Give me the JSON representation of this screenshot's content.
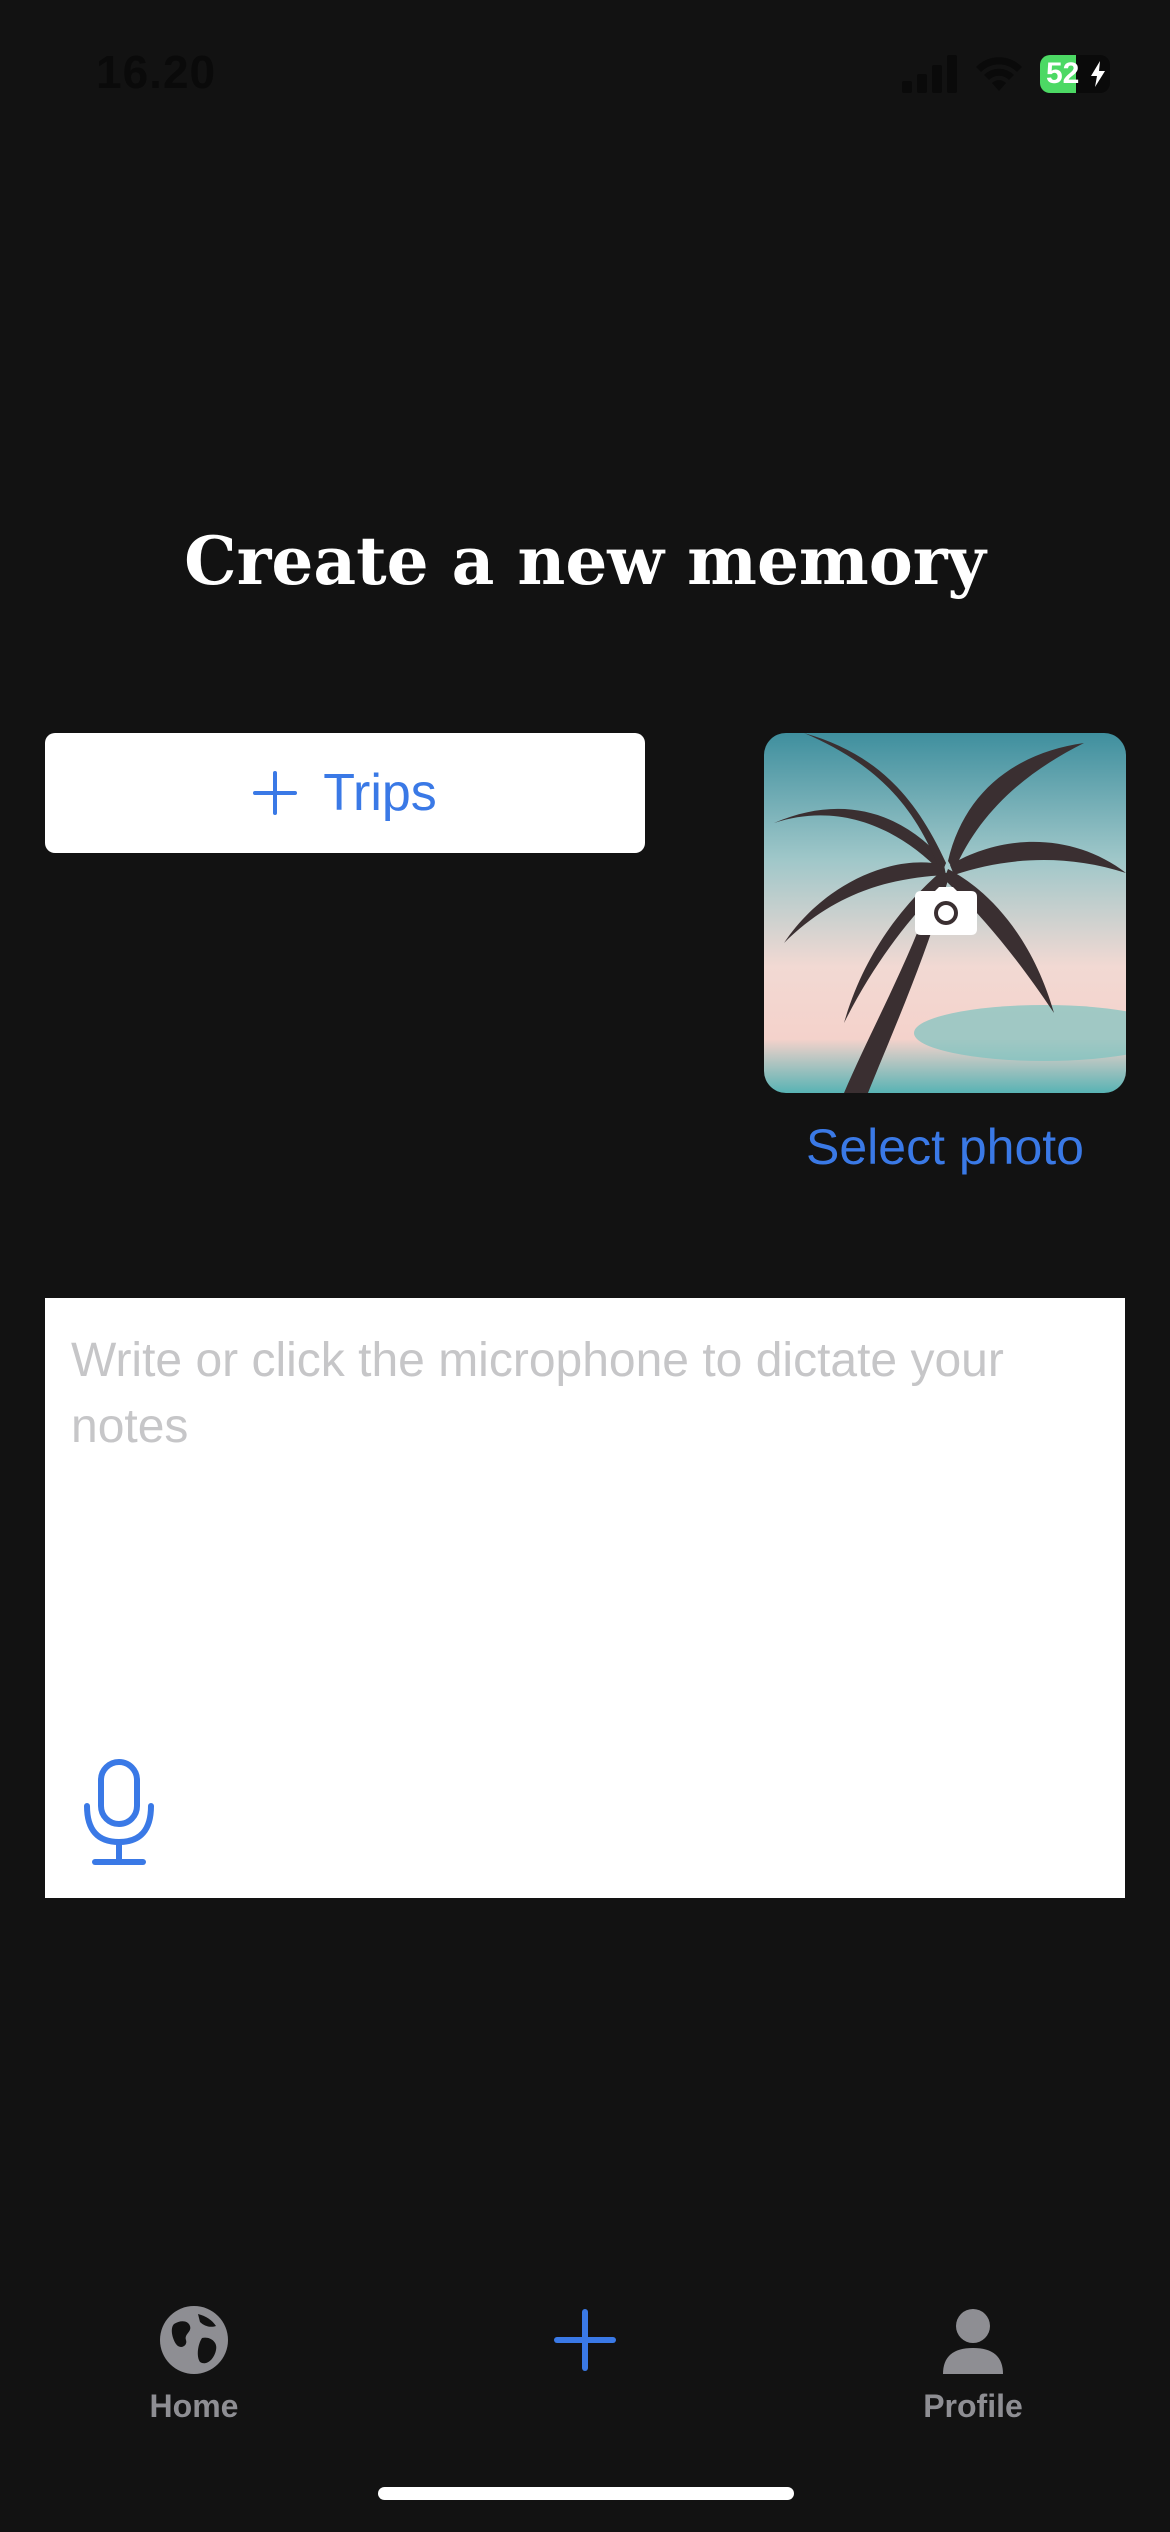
{
  "status_bar": {
    "time": "16.20",
    "battery_percent": "52",
    "battery_level": 0.52,
    "icons": [
      "signal-icon",
      "wifi-icon",
      "battery-icon",
      "charging-bolt-icon"
    ]
  },
  "title": "Create a new memory",
  "trips_button": {
    "icon": "plus-icon",
    "label": "Trips"
  },
  "photo": {
    "icon": "camera-icon",
    "select_label": "Select photo"
  },
  "notes": {
    "value": "",
    "placeholder": "Write or click the microphone to dictate your notes",
    "mic_icon": "microphone-icon"
  },
  "tab_bar": {
    "items": [
      {
        "label": "Home",
        "icon": "globe-icon"
      },
      {
        "label": "",
        "icon": "plus-icon"
      },
      {
        "label": "Profile",
        "icon": "person-icon"
      }
    ]
  },
  "colors": {
    "background": "#121212",
    "accent": "#3a79e6",
    "placeholder": "#c6c6c8",
    "tab_inactive": "#8e8e93",
    "battery_green": "#4cd964"
  }
}
